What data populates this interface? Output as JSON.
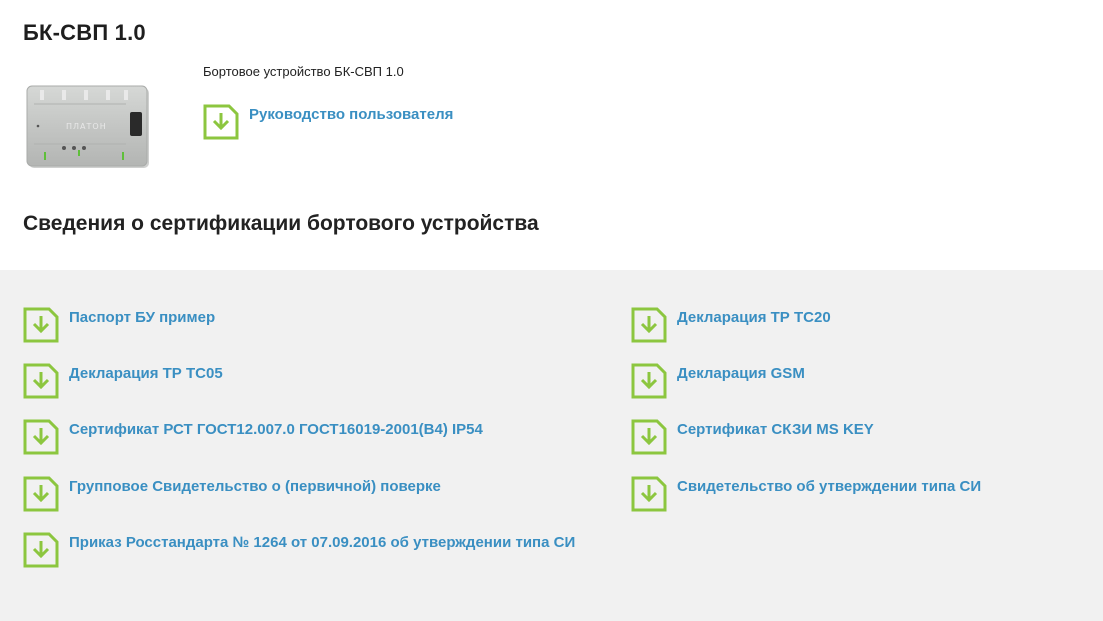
{
  "product": {
    "title": "БК-СВП 1.0",
    "description": "Бортовое устройство БК-СВП 1.0",
    "manual_link": "Руководство пользователя",
    "device_image_logo_text": "ПЛАТОН"
  },
  "certification": {
    "section_title": "Сведения о сертификации бортового устройства",
    "left_docs": [
      "Паспорт БУ пример",
      "Декларация ТР ТС05",
      "Сертификат РСТ ГОСТ12.007.0 ГОСТ16019-2001(В4) IP54",
      "Групповое Свидетельство о (первичной) поверке",
      "Приказ Росстандарта № 1264 от 07.09.2016 об утверждении типа СИ"
    ],
    "right_docs": [
      "Декларация ТР ТС20",
      "Декларация GSM",
      "Сертификат СКЗИ MS KEY",
      "Свидетельство об утверждении типа СИ"
    ]
  },
  "colors": {
    "link": "#3a8fc2",
    "icon_green": "#8cc63f",
    "panel_bg": "#f1f1f1"
  },
  "icons": {
    "download": "download-doc-icon"
  }
}
